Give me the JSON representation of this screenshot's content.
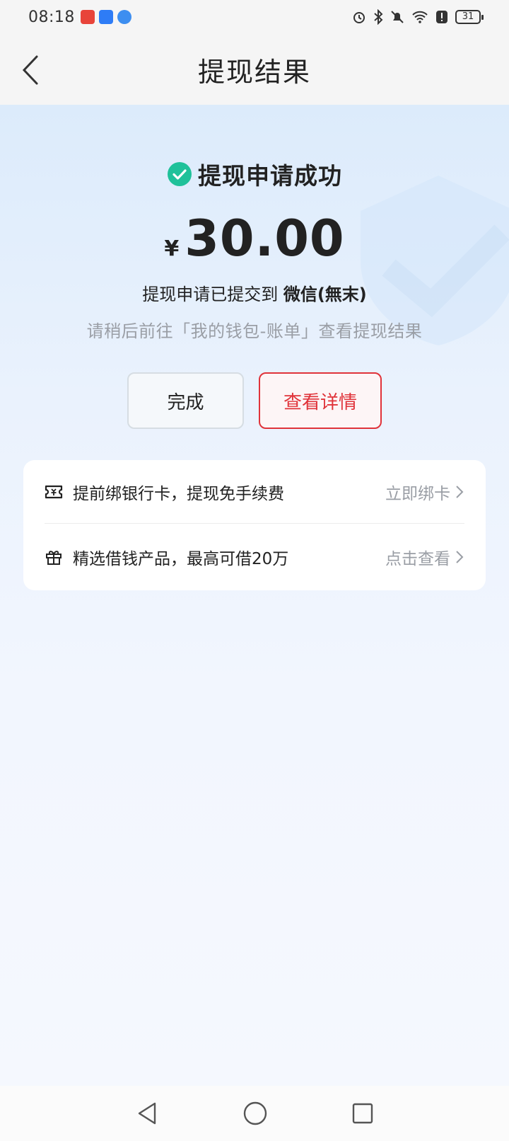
{
  "status_bar": {
    "time": "08:18",
    "battery": "31",
    "icons": [
      "app-icon-red",
      "app-icon-blue",
      "app-icon-globe",
      "alarm-icon",
      "bluetooth-icon",
      "mute-icon",
      "wifi-icon",
      "alert-icon",
      "battery-icon"
    ]
  },
  "nav": {
    "title": "提现结果",
    "back_icon": "chevron-left-icon"
  },
  "result": {
    "status_icon": "check-circle-icon",
    "status_color": "#1fc19a",
    "status_text": "提现申请成功",
    "currency": "¥",
    "amount": "30.00",
    "submitted_prefix": "提现申请已提交到 ",
    "submitted_account": "微信(無末)",
    "hint": "请稍后前往「我的钱包-账单」查看提现结果"
  },
  "buttons": {
    "done": "完成",
    "details": "查看详情",
    "accent": "#e0333a"
  },
  "promo": [
    {
      "icon": "ticket-icon",
      "text": "提前绑银行卡，提现免手续费",
      "action": "立即绑卡"
    },
    {
      "icon": "gift-icon",
      "text": "精选借钱产品，最高可借20万",
      "action": "点击查看"
    }
  ],
  "system_nav": [
    "back-triangle-icon",
    "home-circle-icon",
    "recents-square-icon"
  ]
}
